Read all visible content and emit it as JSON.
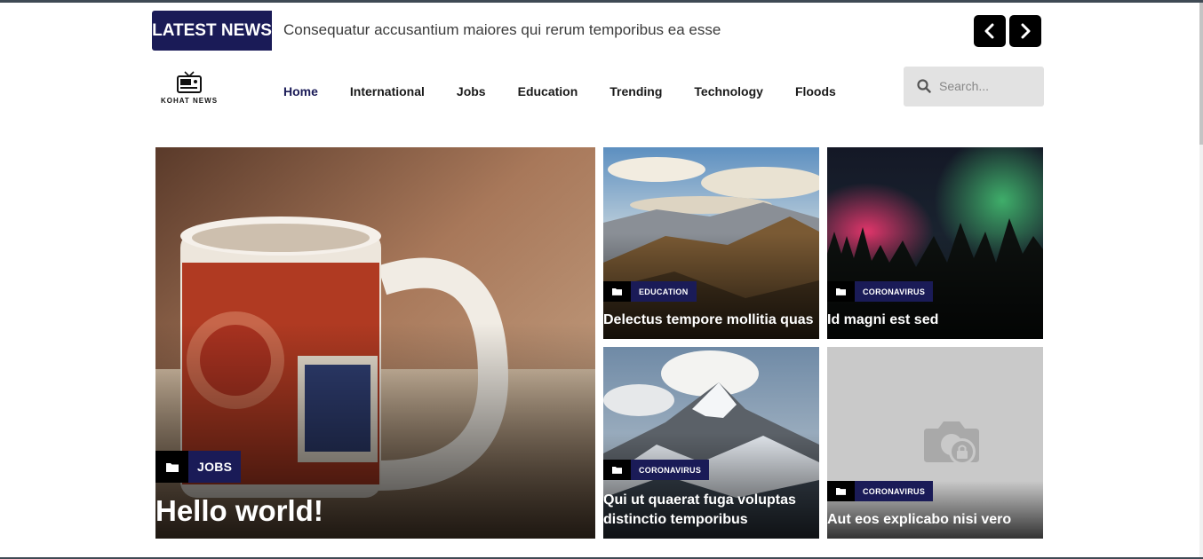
{
  "ticker": {
    "badge": "LATEST NEWS",
    "headline": "Consequatur accusantium maiores qui rerum temporibus ea esse"
  },
  "header": {
    "logo_text": "KOHAT NEWS",
    "nav": [
      "Home",
      "International",
      "Jobs",
      "Education",
      "Trending",
      "Technology",
      "Floods"
    ],
    "active_nav": "Home",
    "search_placeholder": "Search..."
  },
  "posts": [
    {
      "category": "JOBS",
      "title": "Hello world!"
    },
    {
      "category": "EDUCATION",
      "title": "Delectus tempore mollitia quas"
    },
    {
      "category": "CORONAVIRUS",
      "title": "Id magni est sed"
    },
    {
      "category": "CORONAVIRUS",
      "title": "Qui ut quaerat fuga voluptas distinctio temporibus"
    },
    {
      "category": "CORONAVIRUS",
      "title": "Aut eos explicabo nisi vero"
    }
  ],
  "colors": {
    "brand_navy": "#1a1b57",
    "black": "#000000",
    "search_bg": "#e2e2e2"
  }
}
